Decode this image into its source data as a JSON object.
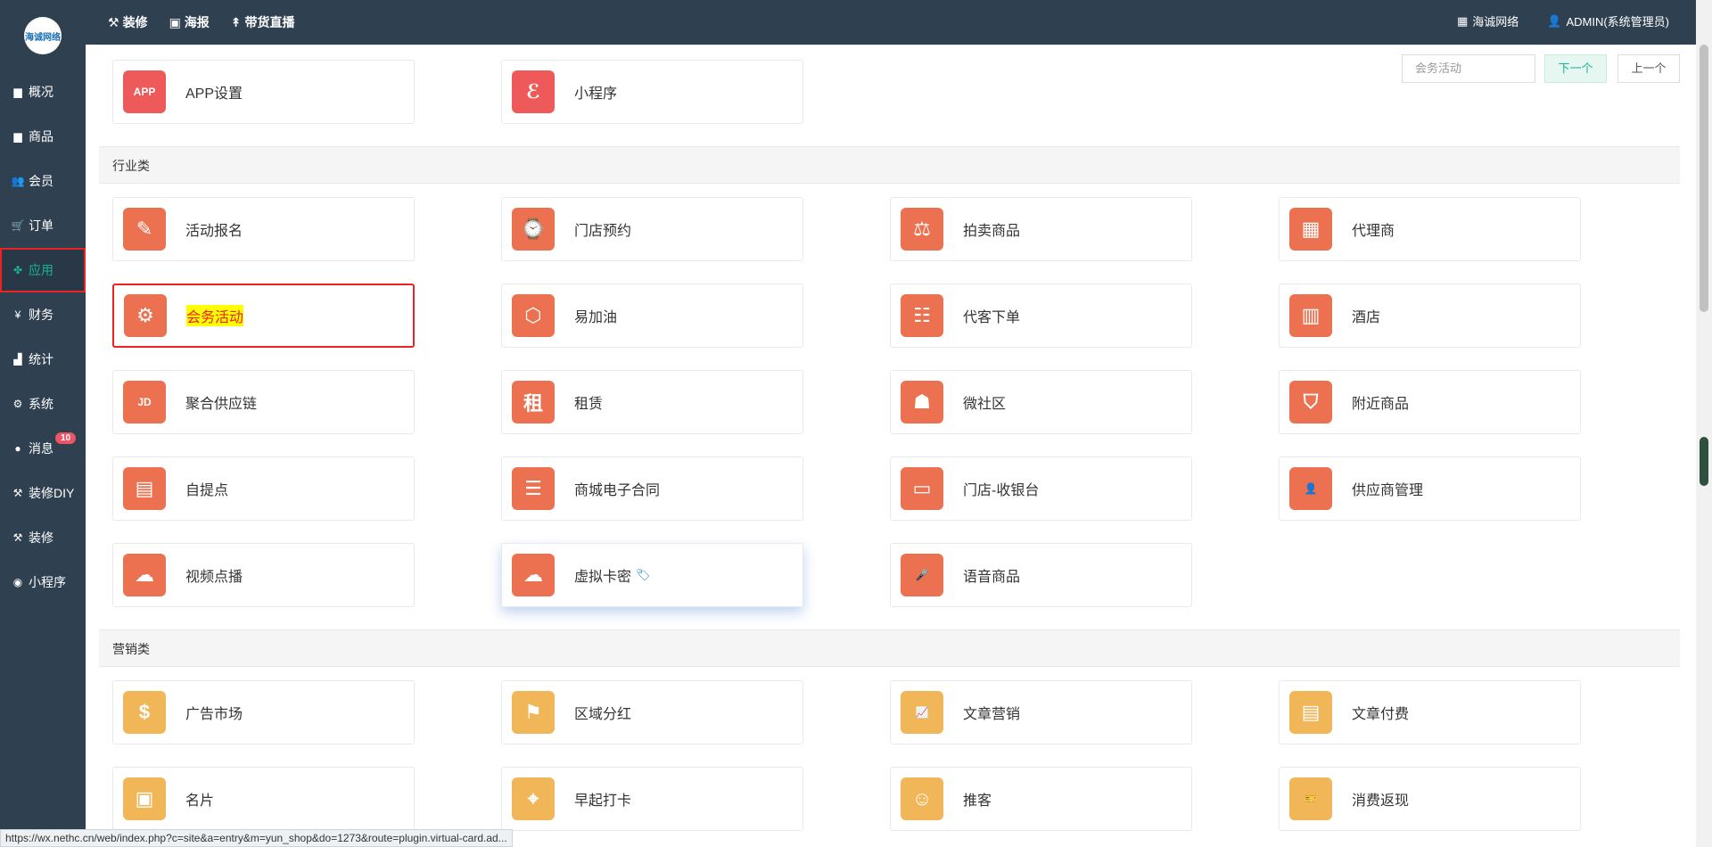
{
  "sidebar": {
    "logo_text": "海诚网络",
    "items": [
      {
        "label": "概况",
        "icon": "dashboard-icon"
      },
      {
        "label": "商品",
        "icon": "box-icon"
      },
      {
        "label": "会员",
        "icon": "users-icon"
      },
      {
        "label": "订单",
        "icon": "cart-icon"
      },
      {
        "label": "应用",
        "icon": "apps-icon",
        "active": true
      },
      {
        "label": "财务",
        "icon": "yen-icon"
      },
      {
        "label": "统计",
        "icon": "chart-icon"
      },
      {
        "label": "系统",
        "icon": "cogs-icon"
      },
      {
        "label": "消息",
        "icon": "chat-icon",
        "badge": "10"
      },
      {
        "label": "装修DIY",
        "icon": "hammer-icon"
      },
      {
        "label": "装修",
        "icon": "hammer-icon"
      },
      {
        "label": "小程序",
        "icon": "wechat-icon"
      }
    ]
  },
  "topbar": {
    "links": [
      "装修",
      "海报",
      "带货直播"
    ],
    "company": "海诚网络",
    "user": "ADMIN(系统管理员)"
  },
  "search": {
    "value": "会务活动",
    "next_label": "下一个",
    "prev_label": "上一个"
  },
  "top_cards": [
    {
      "name": "APP设置",
      "color": "red",
      "icon": "app-icon"
    },
    {
      "name": "小程序",
      "color": "red",
      "icon": "miniprogram-icon"
    }
  ],
  "sections": [
    {
      "title": "行业类",
      "cards": [
        {
          "name": "活动报名",
          "color": "org",
          "icon": "signup-icon"
        },
        {
          "name": "门店预约",
          "color": "org",
          "icon": "store-clock-icon"
        },
        {
          "name": "拍卖商品",
          "color": "org",
          "icon": "auction-icon"
        },
        {
          "name": "代理商",
          "color": "org",
          "icon": "building-icon"
        },
        {
          "name": "会务活动",
          "color": "org",
          "icon": "gear-icon",
          "selected": true
        },
        {
          "name": "易加油",
          "color": "org",
          "icon": "fuel-drop-icon"
        },
        {
          "name": "代客下单",
          "color": "org",
          "icon": "order-person-icon"
        },
        {
          "name": "酒店",
          "color": "org",
          "icon": "hotel-icon"
        },
        {
          "name": "聚合供应链",
          "color": "org",
          "icon": "jd-icon"
        },
        {
          "name": "租赁",
          "color": "org",
          "icon": "rent-icon"
        },
        {
          "name": "微社区",
          "color": "org",
          "icon": "community-icon"
        },
        {
          "name": "附近商品",
          "color": "org",
          "icon": "nearby-icon"
        },
        {
          "name": "自提点",
          "color": "org",
          "icon": "pickup-icon"
        },
        {
          "name": "商城电子合同",
          "color": "org",
          "icon": "contract-icon"
        },
        {
          "name": "门店-收银台",
          "color": "org",
          "icon": "cashier-icon"
        },
        {
          "name": "供应商管理",
          "color": "org",
          "icon": "supplier-icon"
        },
        {
          "name": "视频点播",
          "color": "org",
          "icon": "cloud-play-icon"
        },
        {
          "name": "虚拟卡密",
          "color": "org",
          "icon": "cloud-play-icon",
          "hovered": true,
          "tag": true
        },
        {
          "name": "语音商品",
          "color": "org",
          "icon": "mic-icon"
        }
      ]
    },
    {
      "title": "营销类",
      "cards": [
        {
          "name": "广告市场",
          "color": "yel",
          "icon": "money-bag-icon"
        },
        {
          "name": "区域分红",
          "color": "yel",
          "icon": "flag-icon"
        },
        {
          "name": "文章营销",
          "color": "yel",
          "icon": "chart-up-icon"
        },
        {
          "name": "文章付费",
          "color": "yel",
          "icon": "article-pay-icon"
        },
        {
          "name": "名片",
          "color": "yel",
          "icon": "card-icon"
        },
        {
          "name": "早起打卡",
          "color": "yel",
          "icon": "location-icon"
        },
        {
          "name": "推客",
          "color": "yel",
          "icon": "promoter-icon"
        },
        {
          "name": "消费返现",
          "color": "yel",
          "icon": "ticket-icon"
        }
      ]
    }
  ],
  "statusbar": {
    "url": "https://wx.nethc.cn/web/index.php?c=site&a=entry&m=yun_shop&do=1273&route=plugin.virtual-card.ad..."
  }
}
